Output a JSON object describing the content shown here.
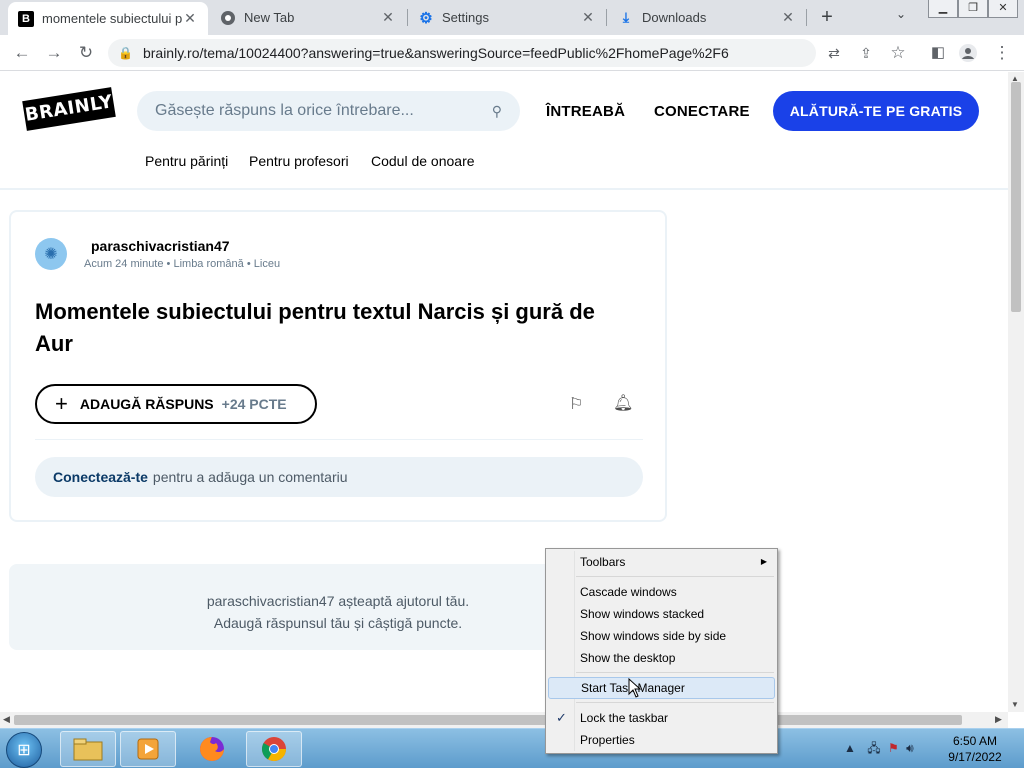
{
  "browser": {
    "tabs": [
      {
        "title": "momentele subiectului p",
        "favicon": "brainly-icon",
        "active": true
      },
      {
        "title": "New Tab",
        "favicon": "chrome-icon",
        "active": false
      },
      {
        "title": "Settings",
        "favicon": "gear-icon",
        "active": false
      },
      {
        "title": "Downloads",
        "favicon": "download-icon",
        "active": false
      }
    ],
    "url": "brainly.ro/tema/10024400?answering=true&answeringSource=feedPublic%2FhomePage%2F6"
  },
  "site": {
    "logo": "BRAINLY",
    "search_placeholder": "Găsește răspuns la orice întrebare...",
    "nav": {
      "ask": "ÎNTREABĂ",
      "login": "CONECTARE",
      "join": "ALĂTURĂ-TE PE GRATIS"
    },
    "subnav": [
      "Pentru părinți",
      "Pentru profesori",
      "Codul de onoare"
    ]
  },
  "question": {
    "author": "paraschivacristian47",
    "time": "Acum 24 minute",
    "subject": "Limba română",
    "level": "Liceu",
    "title": "Momentele subiectului pentru textul Narcis și gură de Aur",
    "add_answer": "ADAUGĂ RĂSPUNS",
    "points": "+24 PCTE",
    "comment_login": "Conectează-te",
    "comment_rest": "pentru a adăuga un comentariu"
  },
  "waiting": {
    "line1": "paraschivacristian47 așteaptă ajutorul tău.",
    "line2": "Adaugă răspunsul tău și câștigă puncte."
  },
  "context_menu": {
    "items": [
      {
        "label": "Toolbars",
        "submenu": true
      },
      {
        "label": "Cascade windows"
      },
      {
        "label": "Show windows stacked"
      },
      {
        "label": "Show windows side by side"
      },
      {
        "label": "Show the desktop"
      },
      {
        "label": "Start Task Manager",
        "highlighted": true
      },
      {
        "label": "Lock the taskbar",
        "checked": true
      },
      {
        "label": "Properties"
      }
    ]
  },
  "taskbar": {
    "apps": [
      "windows-explorer-icon",
      "media-player-icon",
      "firefox-icon",
      "chrome-icon"
    ],
    "time": "6:50 AM",
    "date": "9/17/2022"
  },
  "colors": {
    "brand_blue": "#1a41e8",
    "light_blue": "#ebf2f7",
    "tab_strip": "#dee1e6"
  }
}
